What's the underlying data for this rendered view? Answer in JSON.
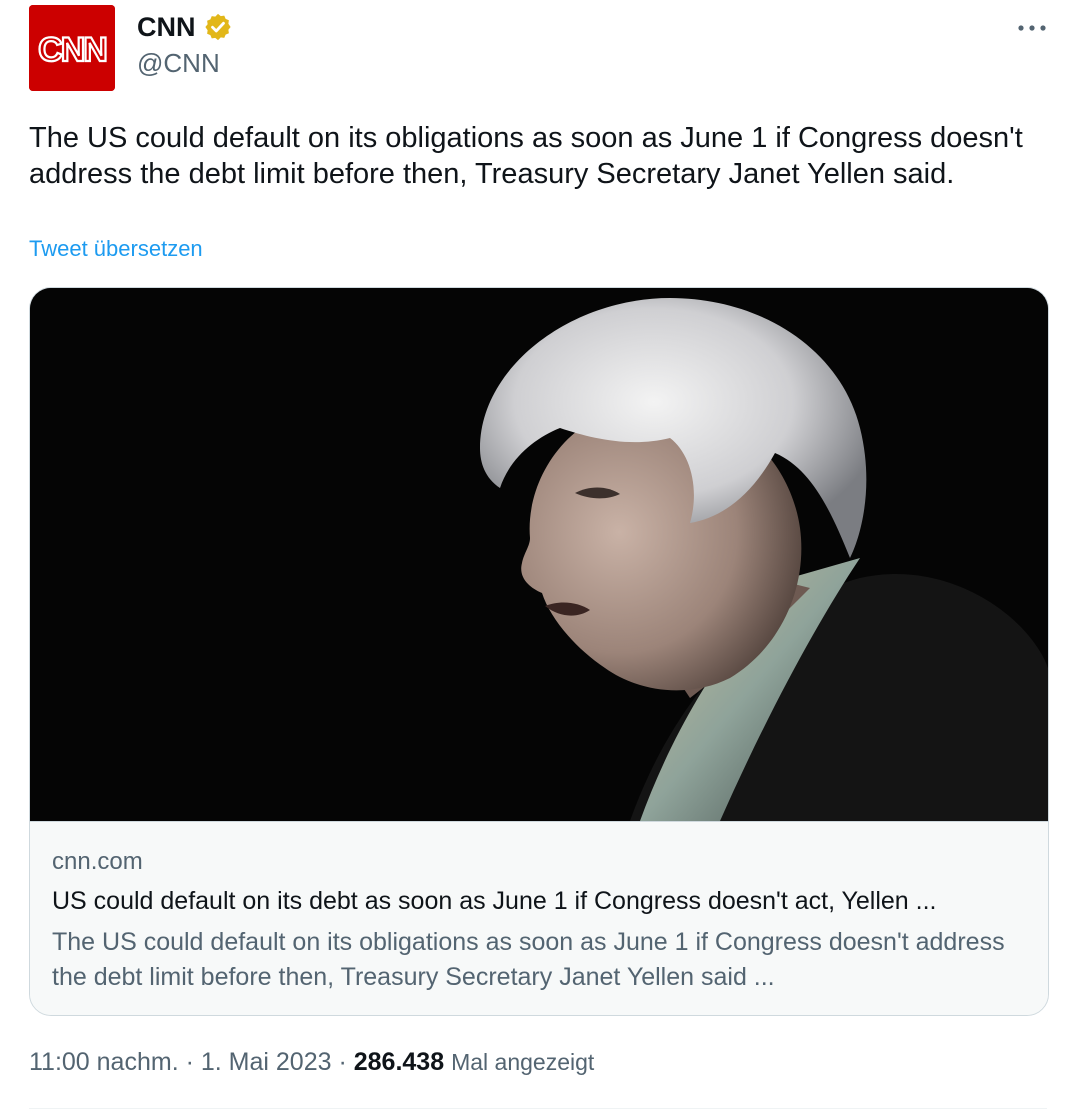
{
  "author": {
    "name": "CNN",
    "handle": "@CNN",
    "avatar_text": "CNN",
    "verified": true
  },
  "tweet": {
    "text": "The US could default on its obligations as soon as June 1 if Congress doesn't address the debt limit before then, Treasury Secretary Janet Yellen said.",
    "translate_label": "Tweet übersetzen"
  },
  "card": {
    "domain": "cnn.com",
    "title": "US could default on its debt as soon as June 1 if Congress doesn't act, Yellen ...",
    "description": "The US could default on its obligations as soon as June 1 if Congress doesn't address the debt limit before then, Treasury Secretary Janet Yellen said ..."
  },
  "meta": {
    "time": "11:00 nachm.",
    "separator": "·",
    "date": "1. Mai 2023",
    "views_count": "286.438",
    "views_label": "Mal angezeigt"
  },
  "icons": {
    "verified": "verified-badge-icon",
    "more": "more-options-icon"
  },
  "colors": {
    "brand_red": "#cc0000",
    "verified_gold": "#e2b719",
    "link_blue": "#1d9bf0",
    "secondary_text": "#536471"
  }
}
